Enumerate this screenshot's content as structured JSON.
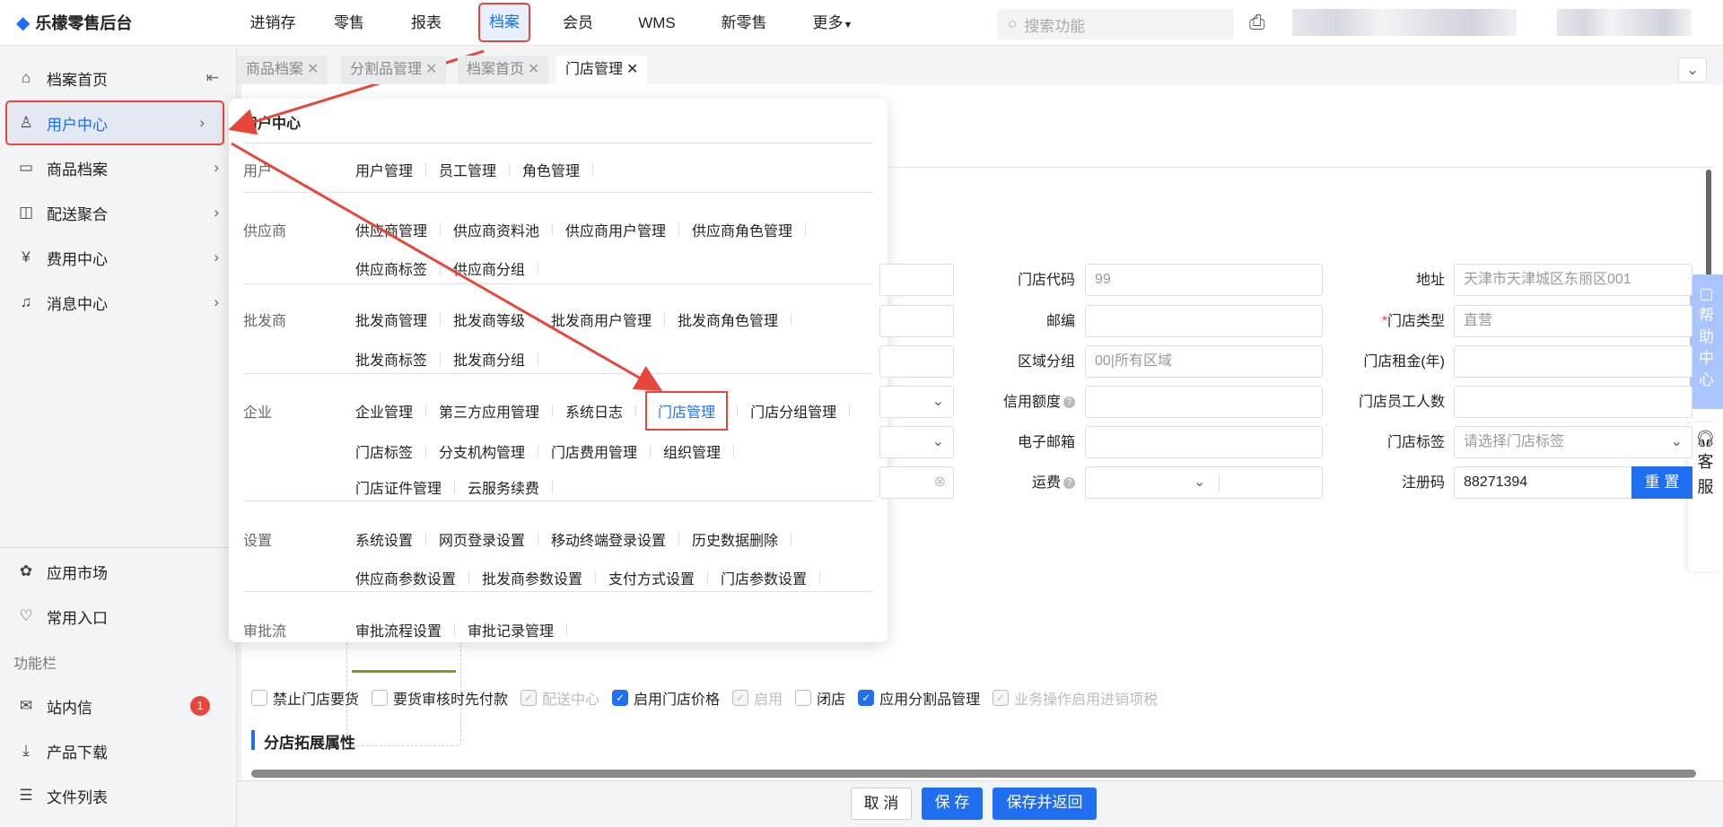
{
  "app": {
    "title": "乐檬零售后台"
  },
  "topnav": {
    "items": [
      "进销存",
      "零售",
      "报表",
      "档案",
      "会员",
      "WMS",
      "新零售",
      "更多"
    ],
    "active": "档案",
    "search_placeholder": "搜索功能"
  },
  "sidebar": {
    "items": [
      {
        "label": "档案首页",
        "icon": "home-icon"
      },
      {
        "label": "用户中心",
        "icon": "user-icon"
      },
      {
        "label": "商品档案",
        "icon": "box-icon"
      },
      {
        "label": "配送聚合",
        "icon": "map-icon"
      },
      {
        "label": "费用中心",
        "icon": "yen-icon"
      },
      {
        "label": "消息中心",
        "icon": "bell-icon"
      }
    ],
    "bottom": [
      {
        "label": "应用市场",
        "icon": "app-market-icon"
      },
      {
        "label": "常用入口",
        "icon": "heart-icon"
      }
    ],
    "section_label": "功能栏",
    "tools": [
      {
        "label": "站内信",
        "icon": "mail-icon",
        "badge": "1"
      },
      {
        "label": "产品下载",
        "icon": "download-icon"
      },
      {
        "label": "文件列表",
        "icon": "file-icon"
      }
    ]
  },
  "tabs": [
    {
      "label": "商品档案"
    },
    {
      "label": "分割品管理"
    },
    {
      "label": "档案首页"
    },
    {
      "label": "门店管理",
      "active": true
    }
  ],
  "menu": {
    "title": "用户中心",
    "groups": [
      {
        "label": "用户",
        "rows": [
          [
            "用户管理",
            "员工管理",
            "角色管理"
          ]
        ]
      },
      {
        "label": "供应商",
        "rows": [
          [
            "供应商管理",
            "供应商资料池",
            "供应商用户管理",
            "供应商角色管理"
          ],
          [
            "供应商标签",
            "供应商分组"
          ]
        ]
      },
      {
        "label": "批发商",
        "rows": [
          [
            "批发商管理",
            "批发商等级",
            "批发商用户管理",
            "批发商角色管理"
          ],
          [
            "批发商标签",
            "批发商分组"
          ]
        ]
      },
      {
        "label": "企业",
        "rows": [
          [
            "企业管理",
            "第三方应用管理",
            "系统日志",
            "门店管理",
            "门店分组管理"
          ],
          [
            "门店标签",
            "分支机构管理",
            "门店费用管理",
            "组织管理"
          ],
          [
            "门店证件管理",
            "云服务续费"
          ]
        ]
      },
      {
        "label": "设置",
        "rows": [
          [
            "系统设置",
            "网页登录设置",
            "移动终端登录设置",
            "历史数据删除"
          ],
          [
            "供应商参数设置",
            "批发商参数设置",
            "支付方式设置",
            "门店参数设置"
          ]
        ]
      },
      {
        "label": "审批流",
        "rows": [
          [
            "审批流程设置",
            "审批记录管理"
          ]
        ]
      }
    ],
    "highlighted": "门店管理"
  },
  "form": {
    "col2": [
      {
        "label": "门店代码",
        "value": "99",
        "placeholder": true
      },
      {
        "label": "邮编",
        "value": ""
      },
      {
        "label": "区域分组",
        "value": "00|所有区域",
        "placeholder": true
      },
      {
        "label": "信用额度",
        "value": "",
        "help": true
      },
      {
        "label": "电子邮箱",
        "value": ""
      },
      {
        "label": "运费",
        "value": "",
        "help": true,
        "select": true
      }
    ],
    "col3": [
      {
        "label": "地址",
        "value": "天津市天津城区东丽区001",
        "placeholder": true
      },
      {
        "label": "门店类型",
        "value": "直营",
        "required": true,
        "placeholder": true
      },
      {
        "label": "门店租金(年)",
        "value": ""
      },
      {
        "label": "门店员工人数",
        "value": ""
      },
      {
        "label": "门店标签",
        "value": "请选择门店标签",
        "placeholder": true,
        "select": true
      },
      {
        "label": "注册码",
        "value": "88271394"
      }
    ],
    "reset_label": "重 置",
    "checkboxes": [
      {
        "label": "禁止门店要货",
        "checked": false
      },
      {
        "label": "要货审核时先付款",
        "checked": false
      },
      {
        "label": "配送中心",
        "checked": true,
        "disabled": true
      },
      {
        "label": "启用门店价格",
        "checked": true
      },
      {
        "label": "启用",
        "checked": true,
        "disabled": true
      },
      {
        "label": "闭店",
        "checked": false
      },
      {
        "label": "应用分割品管理",
        "checked": true
      },
      {
        "label": "业务操作启用进销项税",
        "checked": true,
        "disabled": true
      }
    ],
    "section_title": "分店拓展属性"
  },
  "footer": {
    "cancel": "取 消",
    "save": "保 存",
    "save_return": "保存并返回"
  },
  "float": {
    "help": "帮助中心",
    "service": "客服"
  },
  "colors": {
    "primary": "#1f6ff0",
    "highlight": "#e8463a"
  }
}
